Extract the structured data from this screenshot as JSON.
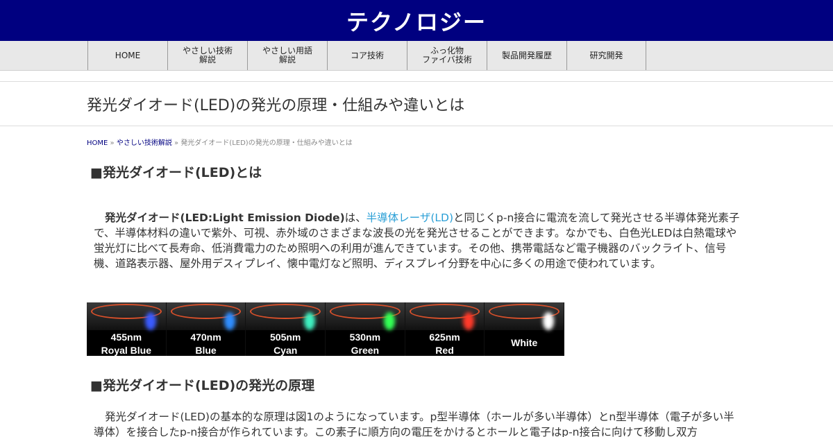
{
  "site": {
    "title": "テクノロジー"
  },
  "nav": {
    "items": [
      {
        "label": "HOME"
      },
      {
        "label": "やさしい技術\n解説"
      },
      {
        "label": "やさしい用語\n解説"
      },
      {
        "label": "コア技術"
      },
      {
        "label": "ふっ化物\nファイバ技術"
      },
      {
        "label": "製品開発履歴"
      },
      {
        "label": "研究開発"
      }
    ]
  },
  "page": {
    "title": "発光ダイオード(LED)の発光の原理・仕組みや違いとは"
  },
  "breadcrumb": {
    "home": "HOME",
    "sep": " » ",
    "category": "やさしい技術解説",
    "current": "発光ダイオード(LED)の発光の原理・仕組みや違いとは"
  },
  "section1": {
    "heading": "■発光ダイオード(LED)とは",
    "bold_term": "発光ダイオード(LED:Light Emission Diode)",
    "text_a": "は、",
    "link": "半導体レーザ(LD)",
    "text_b": "と同じくp-n接合に電流を流して発光させる半導体発光素子で、半導体材料の違いで紫外、可視、赤外域のさまざまな波長の光を発光させることができます。なかでも、白色光LEDは白熱電球や蛍光灯に比べて長寿命、低消費電力のため照明への利用が進んできています。その他、携帯電話など電子機器のバックライト、信号機、道路表示器、屋外用デスィプレイ、懐中電灯など照明、ディスプレイ分野を中心に多くの用途で使われています。"
  },
  "led_image": {
    "cells": [
      {
        "line1": "455nm",
        "line2": "Royal Blue",
        "color": "#3a5bff"
      },
      {
        "line1": "470nm",
        "line2": "Blue",
        "color": "#2f8dff"
      },
      {
        "line1": "505nm",
        "line2": "Cyan",
        "color": "#3ff0c0"
      },
      {
        "line1": "530nm",
        "line2": "Green",
        "color": "#33ff55"
      },
      {
        "line1": "625nm",
        "line2": "Red",
        "color": "#ff3a2a"
      },
      {
        "line1": "",
        "line2": "White",
        "color": "#ffffff"
      }
    ]
  },
  "section2": {
    "heading": "■発光ダイオード(LED)の発光の原理",
    "text": "発光ダイオード(LED)の基本的な原理は図1のようになっています。p型半導体（ホールが多い半導体）とn型半導体（電子が多い半導体）を接合したp-n接合が作られています。この素子に順方向の電圧をかけるとホールと電子はp-n接合に向けて移動し双方"
  }
}
